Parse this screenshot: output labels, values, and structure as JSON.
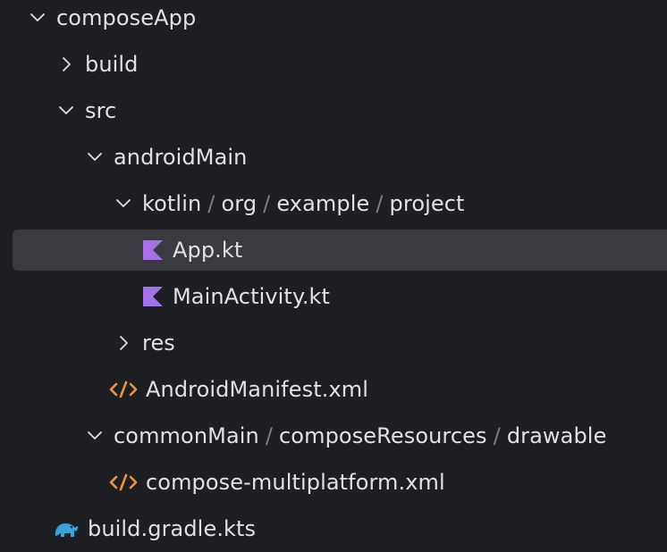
{
  "tree": {
    "compose_app": "composeApp",
    "build": "build",
    "src": "src",
    "android_main": "androidMain",
    "kotlin_path": [
      "kotlin",
      "org",
      "example",
      "project"
    ],
    "app_kt": "App.kt",
    "main_activity_kt": "MainActivity.kt",
    "res": "res",
    "android_manifest": "AndroidManifest.xml",
    "common_path": [
      "commonMain",
      "composeResources",
      "drawable"
    ],
    "compose_xml": "compose-multiplatform.xml",
    "build_gradle": "build.gradle.kts",
    "path_separator": "/"
  },
  "colors": {
    "background": "#1e1f22",
    "selection": "#393b40",
    "text": "#dfe1e5",
    "kotlin_icon": "#a472e6",
    "xml_icon": "#e8973f",
    "gradle_icon": "#3aa2d8"
  },
  "icons": {
    "expanded": "chevron-down-icon",
    "collapsed": "chevron-right-icon",
    "kotlin": "kotlin-file-icon",
    "xml": "xml-file-icon",
    "gradle": "gradle-elephant-icon"
  }
}
